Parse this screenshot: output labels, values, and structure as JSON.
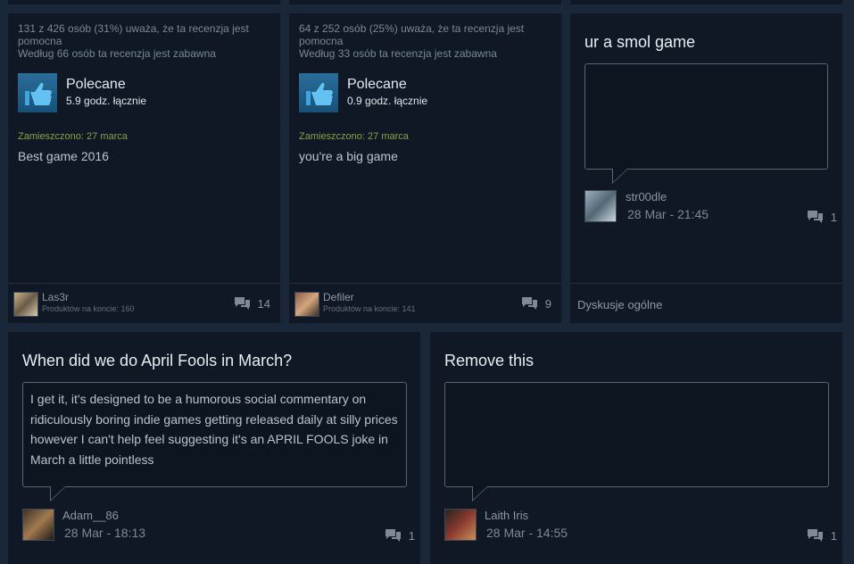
{
  "reviews": [
    {
      "helpful": "131 z 426 osób (31%) uważa, że ta recenzja jest pomocna",
      "funny": "Według 66 osób ta recenzja jest zabawna",
      "recommendation": "Polecane",
      "hours": "5.9 godz. łącznie",
      "posted": "Zamieszczono: 27 marca",
      "text": "Best game 2016",
      "author": "Las3r",
      "products": "Produktów na koncie: 160",
      "comments": "14"
    },
    {
      "helpful": "64 z 252 osób (25%) uważa, że ta recenzja jest pomocna",
      "funny": "Według 33 osób ta recenzja jest zabawna",
      "recommendation": "Polecane",
      "hours": "0.9 godz. łącznie",
      "posted": "Zamieszczono: 27 marca",
      "text": "you're a big game",
      "author": "Defiler",
      "products": "Produktów na koncie: 141",
      "comments": "9"
    }
  ],
  "discussions": [
    {
      "title": "ur a smol game",
      "body": "",
      "author": "str00dle",
      "time": "28 Mar - 21:45",
      "comments": "1",
      "forum": "Dyskusje ogólne"
    },
    {
      "title": "When did we do April Fools in March?",
      "body": "I get it, it's designed to be a humorous social commentary on ridiculously boring indie games getting released daily at silly prices however I can't help feel suggesting it's an APRIL FOOLS joke in March a little pointless",
      "author": "Adam__86",
      "time": "28 Mar - 18:13",
      "comments": "1"
    },
    {
      "title": "Remove this",
      "body": "",
      "author": "Laith Iris",
      "time": "28 Mar - 14:55",
      "comments": "1"
    }
  ],
  "colors": {
    "background": "#1a2738",
    "card": "#0f1824",
    "posted_green": "#8aa14d",
    "thumb_blue": "#2a6d99"
  },
  "icons": {
    "thumbs_up": "thumbs-up-icon",
    "comment": "comment-bubbles-icon"
  }
}
